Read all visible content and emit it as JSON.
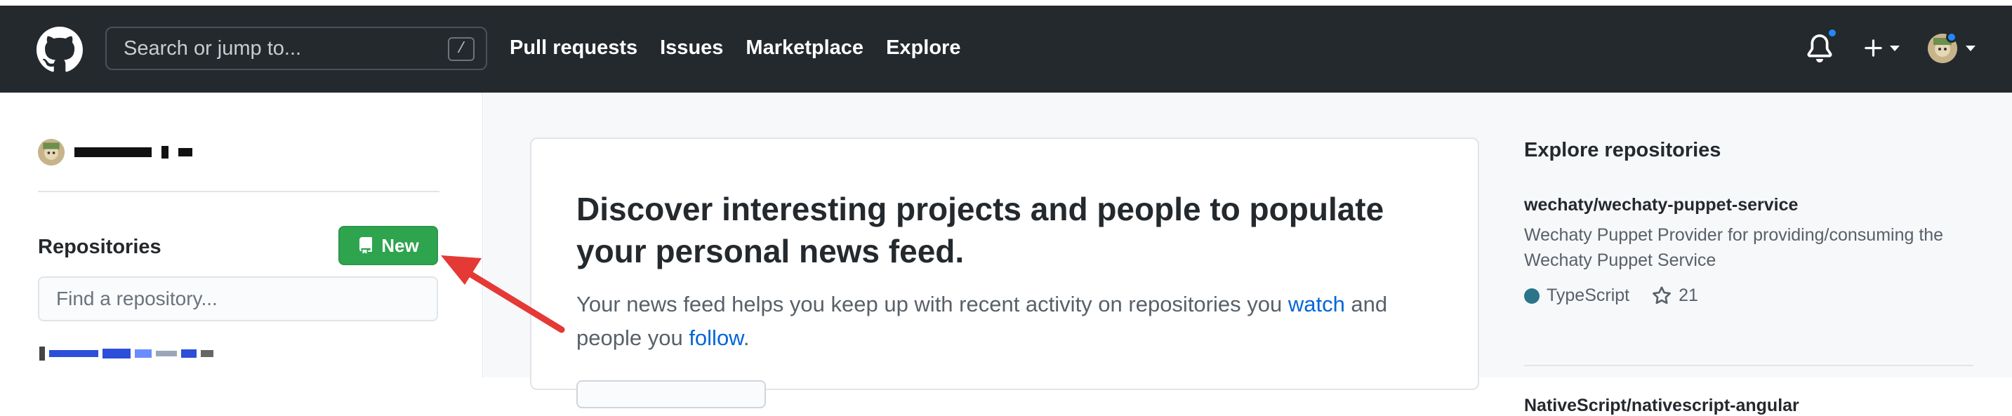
{
  "header": {
    "search_placeholder": "Search or jump to...",
    "search_shortcut": "/",
    "nav": [
      "Pull requests",
      "Issues",
      "Marketplace",
      "Explore"
    ],
    "notification_dot_color": "#2188ff"
  },
  "sidebar": {
    "repositories_title": "Repositories",
    "new_button_label": "New",
    "find_placeholder": "Find a repository..."
  },
  "main": {
    "heading": "Discover interesting projects and people to populate your personal news feed.",
    "text_before_watch": "Your news feed helps you keep up with recent activity on repositories you ",
    "watch_link": "watch",
    "text_between": " and people you ",
    "follow_link": "follow",
    "text_after": "."
  },
  "explore": {
    "title": "Explore repositories",
    "repos": [
      {
        "name": "wechaty/wechaty-puppet-service",
        "description": "Wechaty Puppet Provider for providing/consuming the Wechaty Puppet Service",
        "language": "TypeScript",
        "language_color": "#2b7489",
        "stars": "21"
      },
      {
        "name": "NativeScript/nativescript-angular"
      }
    ]
  },
  "annotation": {
    "arrow_color": "#e53935"
  }
}
